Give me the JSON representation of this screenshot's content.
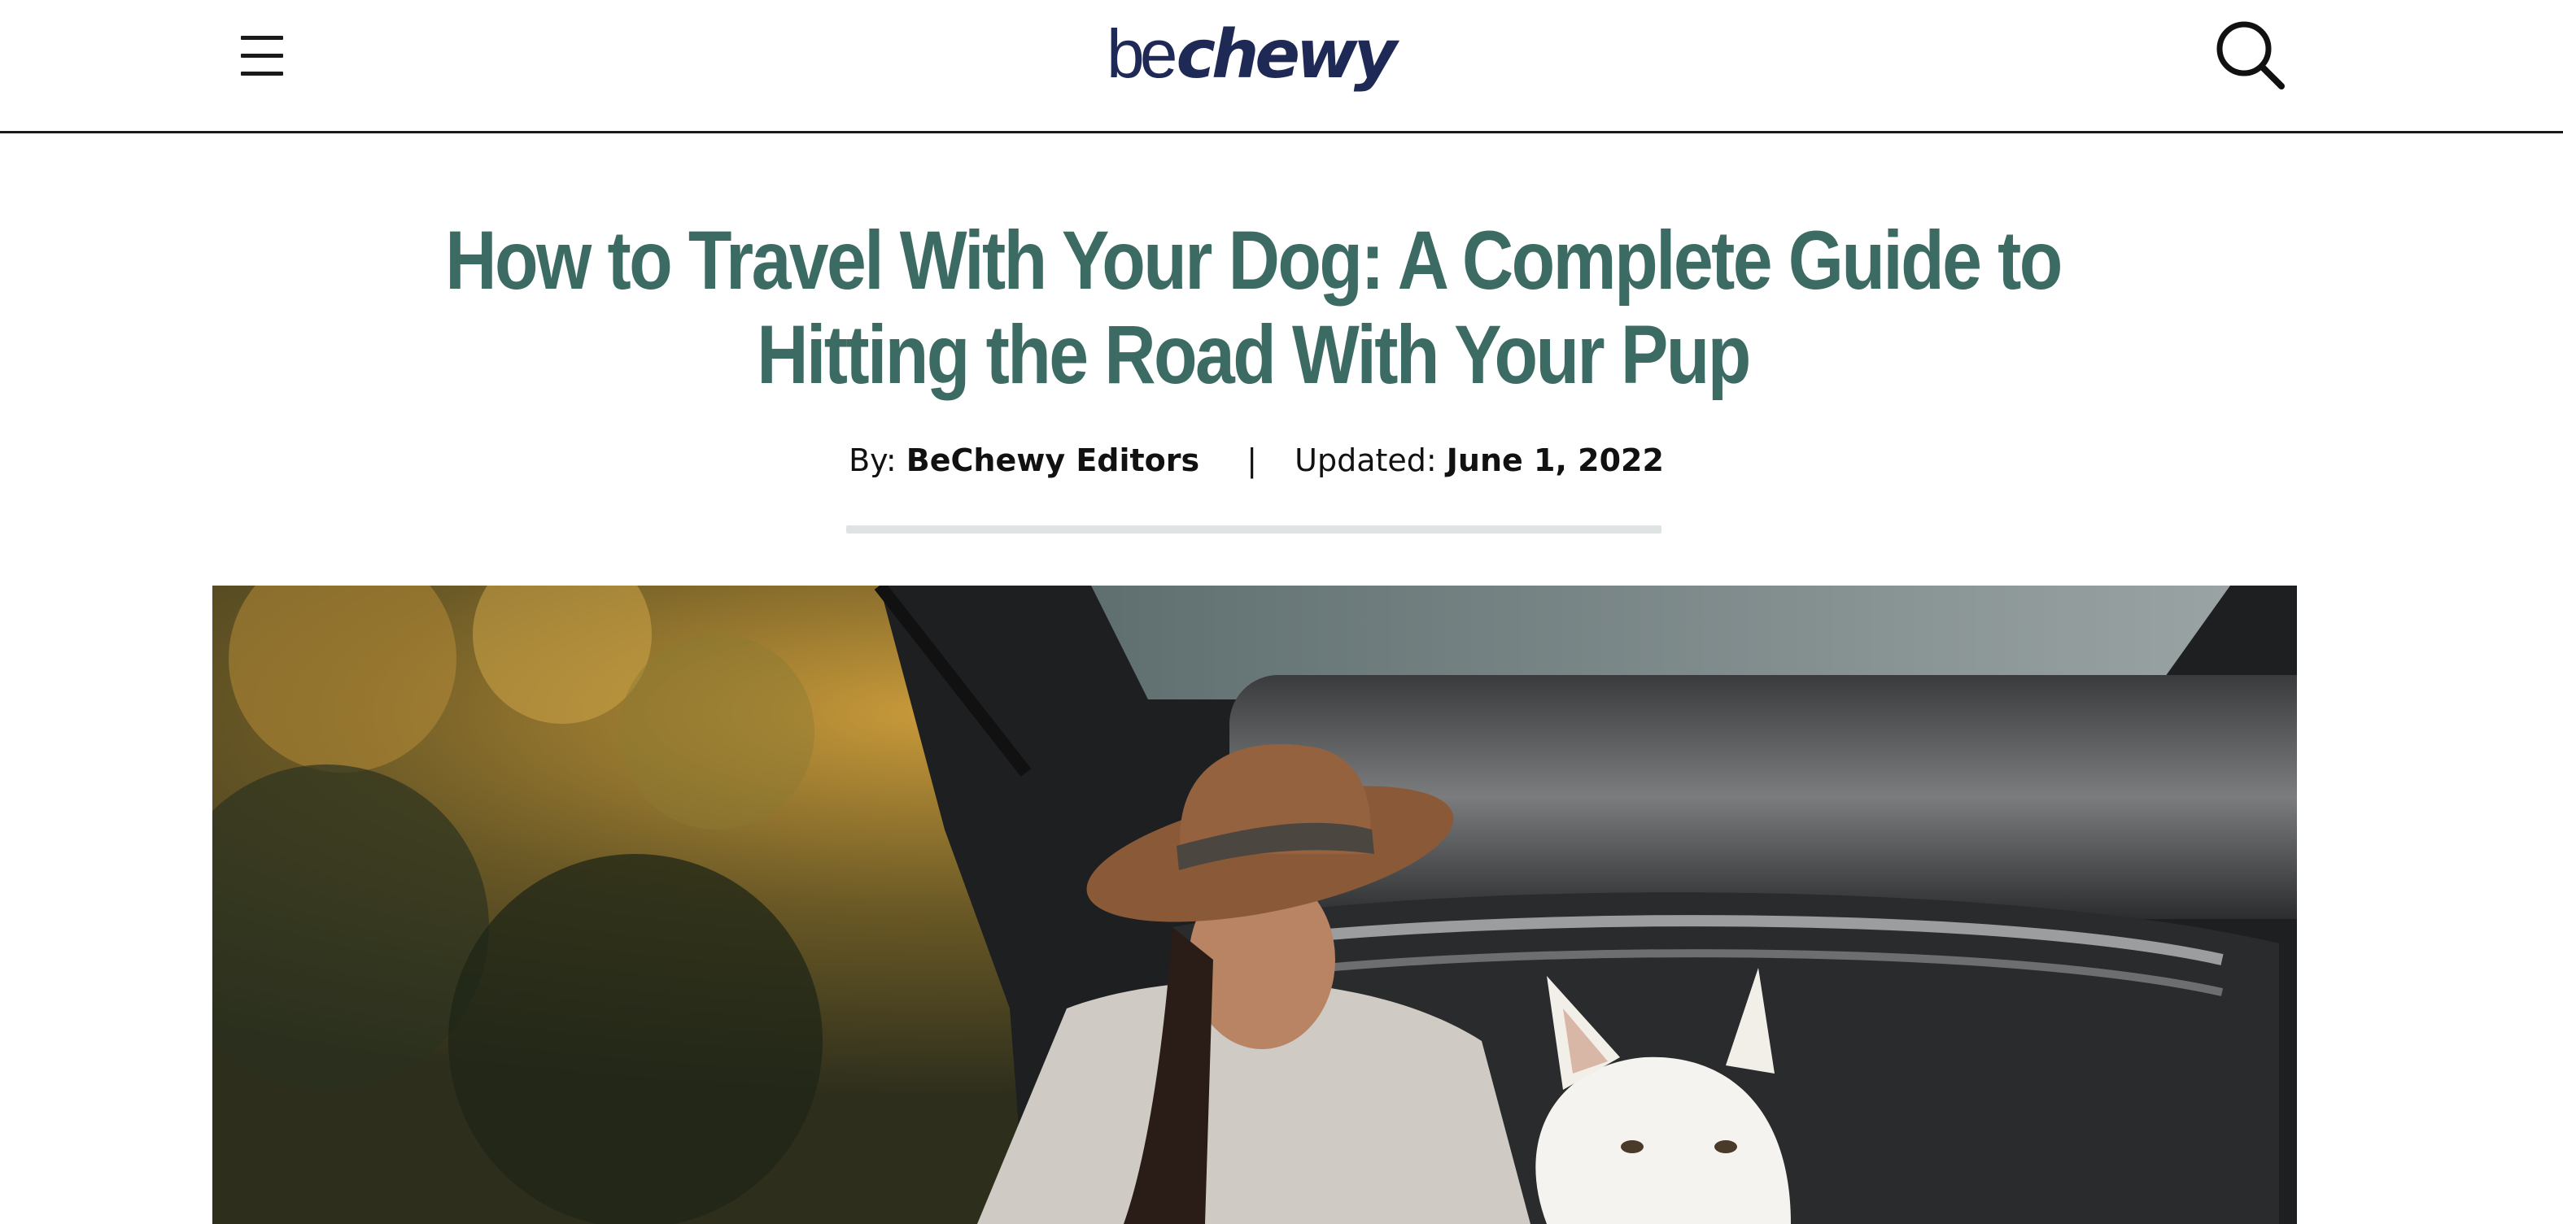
{
  "header": {
    "logo": {
      "prefix": "be",
      "brand": "chewy",
      "color": "#1e2a55"
    },
    "menu_icon": "hamburger-menu-icon",
    "search_icon": "search-icon"
  },
  "article": {
    "title": "How to Travel With Your Dog: A Complete Guide to Hitting the Road With Your Pup",
    "byline": {
      "by_label": "By:",
      "author": "BeChewy Editors",
      "separator": "|",
      "updated_label": "Updated:",
      "date": "June 1, 2022"
    },
    "title_color": "#3c6b64",
    "hero_image": "woman-with-dog-in-car-trunk-photo"
  }
}
